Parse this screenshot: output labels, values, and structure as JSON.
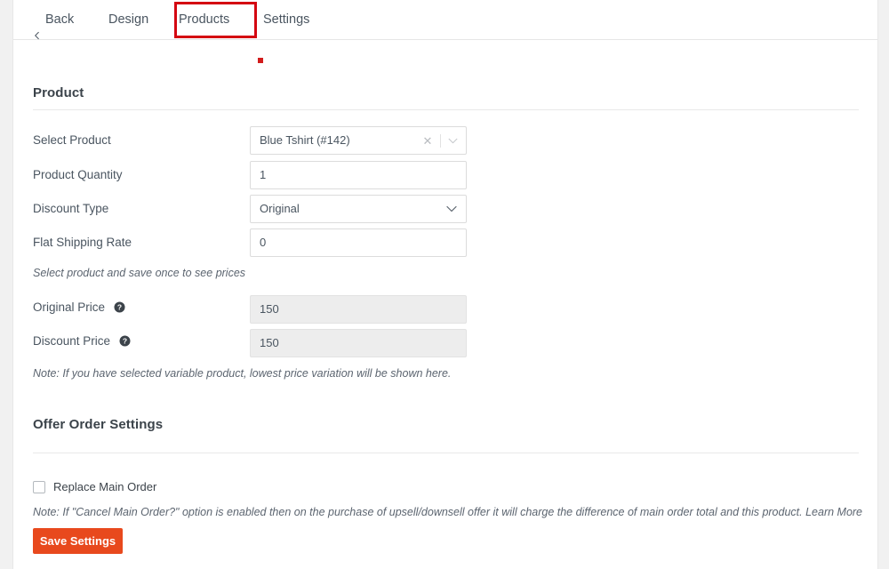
{
  "tabs": {
    "back": "Back",
    "design": "Design",
    "products": "Products",
    "settings": "Settings",
    "highlight_color": "#d40511",
    "marker_color": "#d21c1c"
  },
  "sections": {
    "product_title": "Product",
    "offer_title": "Offer Order Settings"
  },
  "fields": {
    "select_product": {
      "label": "Select Product",
      "value": "Blue Tshirt (#142)",
      "clear_icon": "close-icon",
      "dropdown_icon": "chevron-down-icon"
    },
    "product_quantity": {
      "label": "Product Quantity",
      "value": "1"
    },
    "discount_type": {
      "label": "Discount Type",
      "value": "Original",
      "options": [
        "Original"
      ]
    },
    "flat_shipping_rate": {
      "label": "Flat Shipping Rate",
      "value": "0"
    },
    "original_price": {
      "label": "Original Price",
      "value": "150",
      "help_icon": "question-mark-icon",
      "disabled": true
    },
    "discount_price": {
      "label": "Discount Price",
      "value": "150",
      "help_icon": "question-mark-icon",
      "disabled": true
    }
  },
  "notes": {
    "prices": "Select product and save once to see prices",
    "variable": "Note: If you have selected variable product, lowest price variation will be shown here.",
    "cancel_order": "Note: If \"Cancel Main Order?\" option is enabled then on the purchase of upsell/downsell offer it will charge the difference of main order total and this product. Learn More"
  },
  "offer_settings": {
    "replace_main_order_label": "Replace Main Order",
    "replace_main_order_checked": false
  },
  "actions": {
    "save_label": "Save Settings",
    "save_color": "#e8491d"
  }
}
